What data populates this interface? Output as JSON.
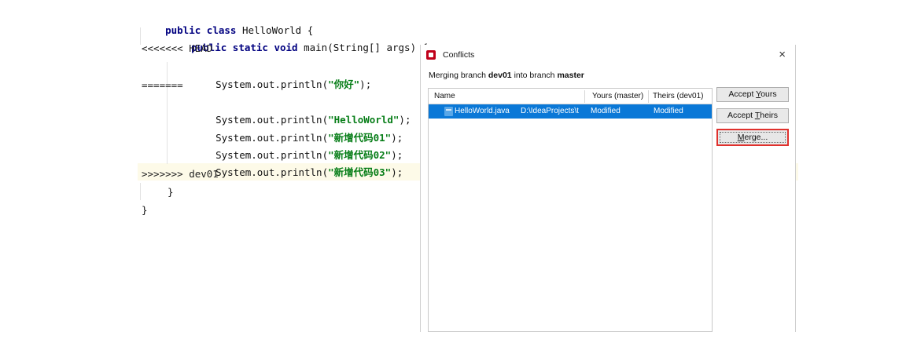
{
  "editor": {
    "lines": [
      {
        "keyword": "public class",
        "text": " HelloWorld {"
      },
      {
        "keyword": "public static void",
        "text": " main(String[] args) {"
      },
      {
        "text": "<<<<<<< HEAD"
      },
      {
        "prefix": "System.out.println(",
        "string": "\"你好\"",
        "suffix": ");"
      },
      {
        "text": "======="
      },
      {
        "prefix": "System.out.println(",
        "string": "\"HelloWorld\"",
        "suffix": ");"
      },
      {
        "prefix": "System.out.println(",
        "string": "\"新增代码01\"",
        "suffix": ");"
      },
      {
        "prefix": "System.out.println(",
        "string": "\"新增代码02\"",
        "suffix": ");"
      },
      {
        "prefix": "System.out.println(",
        "string": "\"新增代码03\"",
        "suffix": ");"
      },
      {
        "text": ">>>>>>> dev01"
      },
      {
        "text": "}"
      },
      {
        "text": "}"
      }
    ],
    "colors": {
      "keyword": "#000080",
      "string": "#067d17",
      "highlight": "#fdfae8"
    }
  },
  "dialog": {
    "title": "Conflicts",
    "close_glyph": "×",
    "message": {
      "prefix": "Merging branch ",
      "source": "dev01",
      "middle": " into branch ",
      "target": "master"
    },
    "table": {
      "columns": [
        "Name",
        "Yours (master)",
        "Theirs (dev01)"
      ],
      "rows": [
        {
          "file": "HelloWorld.java",
          "path": "D:\\IdeaProjects\\t",
          "yours": "Modified",
          "theirs": "Modified",
          "selected": true
        }
      ]
    },
    "buttons": {
      "accept_yours": {
        "before": "Accept ",
        "mnemonic": "Y",
        "after": "ours"
      },
      "accept_theirs": {
        "before": "Accept ",
        "mnemonic": "T",
        "after": "heirs"
      },
      "merge": {
        "mnemonic": "M",
        "after": "erge..."
      }
    },
    "colors": {
      "selection": "#0a78d7",
      "merge_outline": "#e0312d"
    }
  }
}
